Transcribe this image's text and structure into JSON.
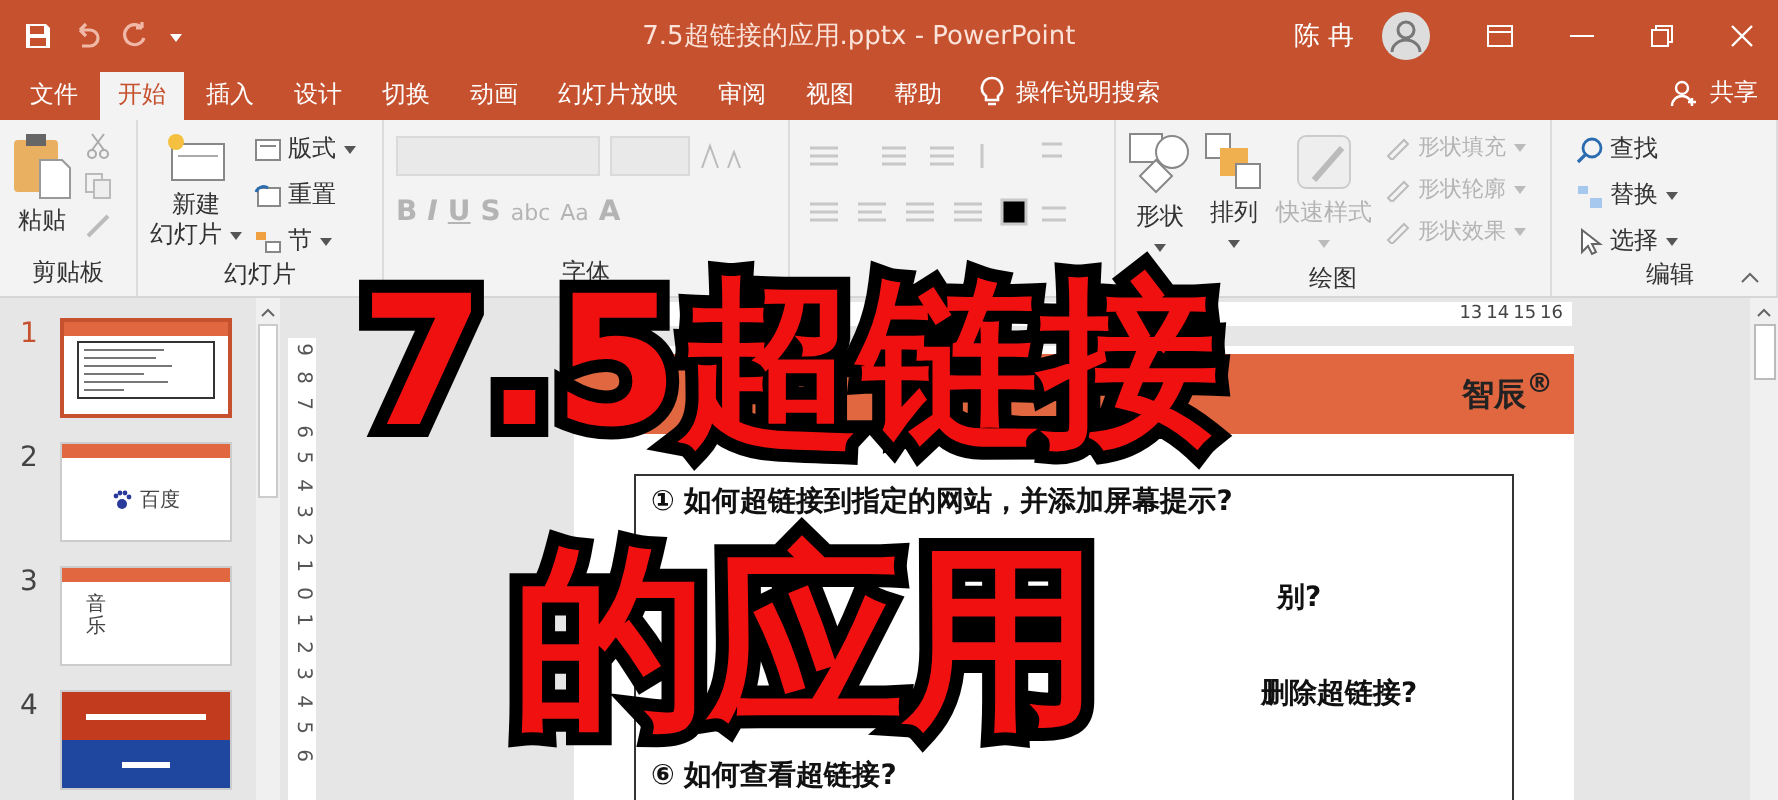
{
  "title_bar": {
    "title": "7.5超链接的应用.pptx  -  PowerPoint",
    "user": "陈 冉"
  },
  "tabs": [
    {
      "label": "文件",
      "selected": false
    },
    {
      "label": "开始",
      "selected": true
    },
    {
      "label": "插入",
      "selected": false
    },
    {
      "label": "设计",
      "selected": false
    },
    {
      "label": "切换",
      "selected": false
    },
    {
      "label": "动画",
      "selected": false
    },
    {
      "label": "幻灯片放映",
      "selected": false
    },
    {
      "label": "审阅",
      "selected": false
    },
    {
      "label": "视图",
      "selected": false
    },
    {
      "label": "帮助",
      "selected": false
    }
  ],
  "tell_me": "操作说明搜索",
  "share": "共享",
  "ribbon": {
    "clipboard": {
      "paste": "粘贴",
      "label": "剪贴板"
    },
    "slides": {
      "new_slide": [
        "新建",
        "幻灯片"
      ],
      "layout": "版式",
      "reset": "重置",
      "section": "节",
      "label": "幻灯片"
    },
    "font": {
      "label": "字体",
      "buttons": [
        {
          "text": "B",
          "disabled": true
        },
        {
          "text": "I",
          "disabled": true
        },
        {
          "text": "U",
          "disabled": true
        },
        {
          "text": "S",
          "disabled": true
        },
        {
          "text": "abc",
          "disabled": true
        },
        {
          "text": "Aa",
          "disabled": true
        },
        {
          "text": "A",
          "disabled": true
        }
      ]
    },
    "drawing": {
      "label": "绘图",
      "shapes": "形状",
      "arrange": "排列",
      "quick_styles": {
        "text": "快速样式",
        "disabled": true
      },
      "format": [
        {
          "text": "形状填充",
          "disabled": true
        },
        {
          "text": "形状轮廓",
          "disabled": true
        },
        {
          "text": "形状效果",
          "disabled": true
        }
      ]
    },
    "editing": {
      "label": "编辑",
      "items": [
        "查找",
        "替换",
        "选择"
      ]
    }
  },
  "thumbnails": [
    {
      "number": "1",
      "selected": true,
      "kind": "list"
    },
    {
      "number": "2",
      "selected": false,
      "kind": "logo",
      "text": "百度"
    },
    {
      "number": "3",
      "selected": false,
      "kind": "vertical",
      "text": "音乐"
    },
    {
      "number": "4",
      "selected": false,
      "kind": "cover"
    }
  ],
  "horizontal_ruler": [
    "13",
    "14",
    "15",
    "16"
  ],
  "vertical_ruler": [
    "9",
    "8",
    "7",
    "6",
    "5",
    "4",
    "3",
    "2",
    "1",
    "0",
    "1",
    "2",
    "3",
    "4",
    "5",
    "6"
  ],
  "slide": {
    "brand": "智辰$^{®}$",
    "lines": [
      [
        "① 如何超链接到指定的网站，并添加屏幕提示?"
      ],
      [
        "别?"
      ],
      [
        "删除超链接?"
      ],
      [
        "⑥ 如何查看超链接?"
      ]
    ]
  },
  "overlay": {
    "lines": [
      "7.5超链接",
      "的应用"
    ]
  }
}
